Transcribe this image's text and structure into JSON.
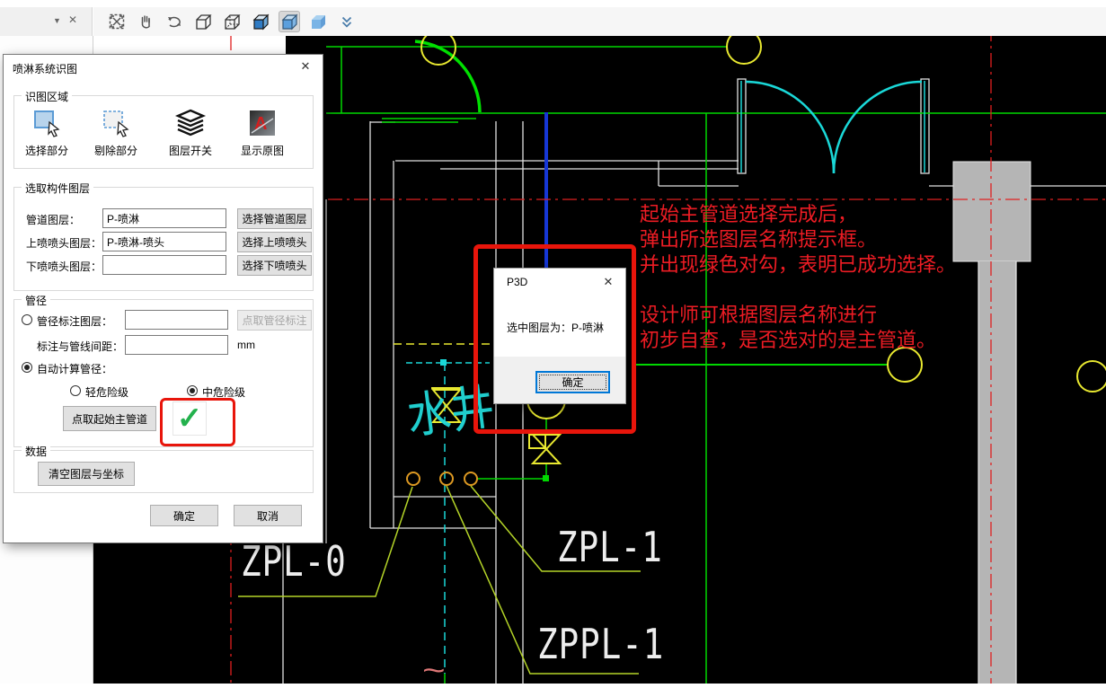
{
  "app": {
    "tab_strip": {
      "dropdown_icon": "▼",
      "close_icon": "✕"
    },
    "toolbar_icons": [
      "zoom-extents",
      "pan",
      "orbit",
      "wireframe-cube",
      "hidden-line-cube",
      "shaded-cube",
      "shaded-cube-active",
      "solid-cube",
      "expand-more"
    ]
  },
  "dialog": {
    "title": "喷淋系统识图",
    "close_icon": "✕",
    "recognition_area": {
      "label": "识图区域",
      "select_part": "选择部分",
      "remove_part": "剔除部分",
      "layer_switch": "图层开关",
      "show_original": "显示原图"
    },
    "component_layers": {
      "label": "选取构件图层",
      "pipe": {
        "label": "管道图层：",
        "value": "P-喷淋",
        "button": "选择管道图层"
      },
      "upper": {
        "label": "上喷喷头图层：",
        "value": "P-喷淋-喷头",
        "button": "选择上喷喷头"
      },
      "lower": {
        "label": "下喷喷头图层：",
        "value": "",
        "button": "选择下喷喷头"
      }
    },
    "pipe_diameter": {
      "label": "管径",
      "annotation_layer_label": "管径标注图层：",
      "annotation_layer_value": "",
      "pick_annotation_button": "点取管径标注",
      "spacing_label": "标注与管线间距：",
      "spacing_value": "",
      "spacing_unit": "mm",
      "auto_calc_label": "自动计算管径：",
      "light_risk_label": "轻危险级",
      "medium_risk_label": "中危险级",
      "pick_main_pipe_button": "点取起始主管道",
      "check_icon": "✓"
    },
    "data_group": {
      "label": "数据",
      "clear_button": "清空图层与坐标"
    },
    "ok_button": "确定",
    "cancel_button": "取消"
  },
  "message_box": {
    "title": "P3D",
    "close_icon": "✕",
    "body": "选中图层为：P-喷淋",
    "ok_button": "确定"
  },
  "annotations": {
    "lines_top": [
      "起始主管道选择完成后，",
      "弹出所选图层名称提示框。",
      "并出现绿色对勾，表明已成功选择。"
    ],
    "lines_bottom": [
      "设计师可根据图层名称进行",
      "初步自查，是否选对的是主管道。"
    ],
    "color": "#ed1c24"
  },
  "cad": {
    "labels": {
      "zpl0": "ZPL-0",
      "zpl1": "ZPL-1",
      "zppl1": "ZPPL-1",
      "well": "水井",
      "break_symbol": "~"
    }
  },
  "colors": {
    "annotation_red": "#ed1c24",
    "highlight_red": "#e8150b",
    "check_green": "#23b14d",
    "cad_green": "#00d800",
    "cad_yellow": "#e8e830",
    "cad_cyan": "#1ad8d8",
    "cad_blue": "#1637d6",
    "canvas_black": "#000000"
  }
}
